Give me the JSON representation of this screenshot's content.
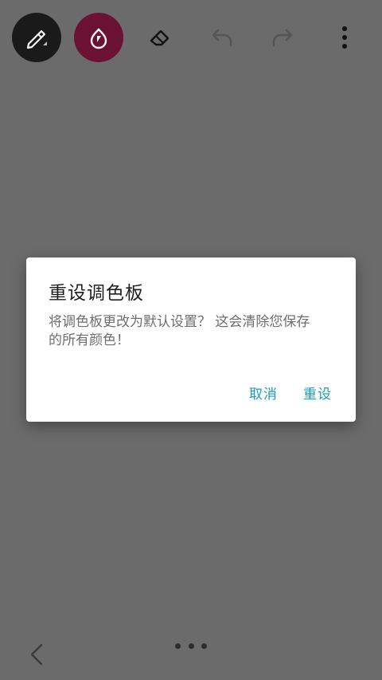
{
  "toolbar": {
    "tools": [
      {
        "name": "pen-tool",
        "icon": "pen-icon"
      },
      {
        "name": "color-tool",
        "icon": "ink-drop-icon"
      },
      {
        "name": "eraser-tool",
        "icon": "eraser-icon"
      },
      {
        "name": "undo",
        "icon": "undo-icon"
      },
      {
        "name": "redo",
        "icon": "redo-icon"
      },
      {
        "name": "more",
        "icon": "more-vert-icon"
      }
    ],
    "active_color": "#6b1233"
  },
  "dialog": {
    "title": "重设调色板",
    "message_line1": "将调色板更改为默认设置？ 这会清除您保存",
    "message_line2": "的所有颜色！",
    "cancel_label": "取消",
    "confirm_label": "重设",
    "accent_color": "#1a9bb8"
  },
  "navbar": {
    "back_icon": "back-chevron-icon",
    "menu_icon": "three-dots-icon"
  },
  "colors": {
    "scrim": "#6b6b6b",
    "dialog_bg": "#ffffff"
  }
}
